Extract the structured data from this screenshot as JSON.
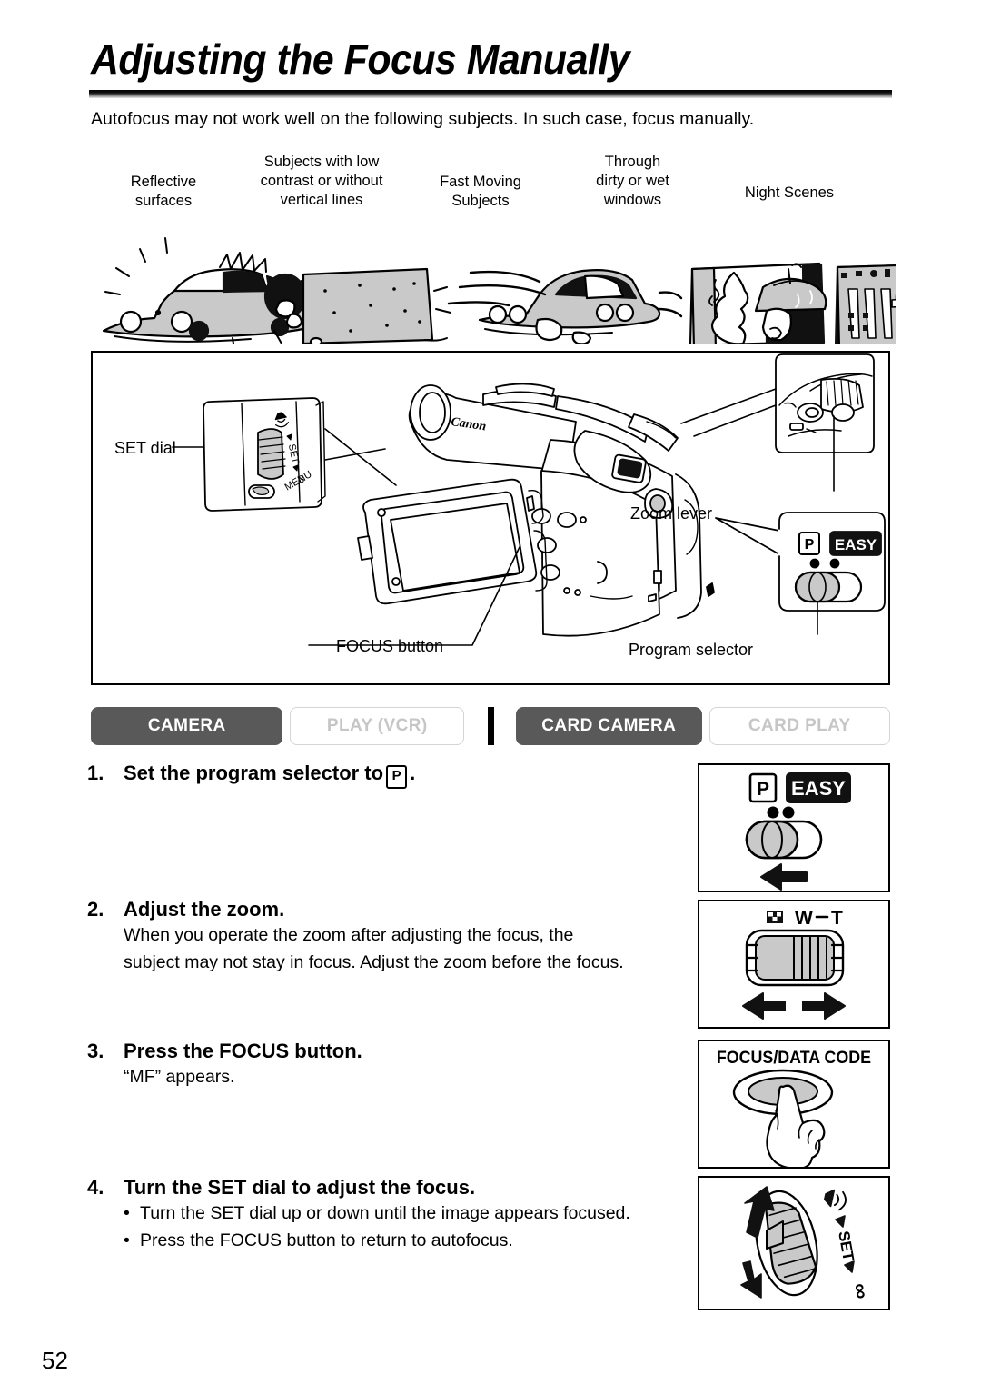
{
  "page": {
    "title": "Adjusting the Focus Manually",
    "intro": "Autofocus may not work well on the following subjects. In such case, focus manually.",
    "number": "52"
  },
  "subjects": [
    {
      "label": "Reflective\nsurfaces",
      "line1": "Reflective",
      "line2": "surfaces",
      "line3": "",
      "icon": "reflective-car-illustration"
    },
    {
      "label": "Subjects with low contrast or without vertical lines",
      "line1": "Subjects with low",
      "line2": "contrast or without",
      "line3": "vertical lines",
      "icon": "low-contrast-panel-illustration"
    },
    {
      "label": "Fast Moving Subjects",
      "line1": "Fast Moving",
      "line2": "Subjects",
      "line3": "",
      "icon": "fast-car-illustration"
    },
    {
      "label": "Through dirty or wet windows",
      "line1": "Through",
      "line2": "dirty or wet",
      "line3": "windows",
      "icon": "wet-window-illustration"
    },
    {
      "label": "Night Scenes",
      "line1": "Night Scenes",
      "line2": "",
      "line3": "",
      "icon": "night-scene-illustration"
    }
  ],
  "diagram": {
    "set_dial_label": "SET dial",
    "zoom_lever_label": "Zoom lever",
    "focus_button_label": "FOCUS button",
    "program_selector_label": "Program selector",
    "brand": "Canon",
    "menu_label": "MENU",
    "set_label": "SET",
    "program_p": "P",
    "program_easy": "EASY"
  },
  "tabs": [
    {
      "label": "CAMERA",
      "state": "active"
    },
    {
      "label": "PLAY (VCR)",
      "state": "inactive"
    },
    {
      "label": "CARD CAMERA",
      "state": "active"
    },
    {
      "label": "CARD PLAY",
      "state": "inactive"
    }
  ],
  "steps": [
    {
      "number": "1.",
      "title_before": "Set the program selector to",
      "title_glyph": "P",
      "title_after": ".",
      "body": "",
      "bullets": [],
      "figure": {
        "name": "program-selector-figure",
        "p_label": "P",
        "easy_label": "EASY",
        "arrow": "left"
      }
    },
    {
      "number": "2.",
      "title_before": "Adjust the zoom.",
      "title_glyph": "",
      "title_after": "",
      "body_line1": "When you operate the zoom after adjusting the focus, the",
      "body_line2": "subject may not stay in focus. Adjust the zoom before the focus.",
      "bullets": [],
      "figure": {
        "name": "zoom-lever-figure",
        "wide_label": "W",
        "tele_label": "T",
        "separator": "–",
        "arrow": "both"
      }
    },
    {
      "number": "3.",
      "title_before": "Press the FOCUS button.",
      "title_glyph": "",
      "title_after": "",
      "body_line1": "“MF” appears.",
      "bullets": [],
      "figure": {
        "name": "focus-button-figure",
        "button_label": "FOCUS/DATA CODE"
      }
    },
    {
      "number": "4.",
      "title_before": "Turn the SET dial to adjust the focus.",
      "title_glyph": "",
      "title_after": "",
      "body_line1": "",
      "bullets": [
        "Turn the SET dial up or down until the image appears focused.",
        "Press the FOCUS button to return to autofocus."
      ],
      "figure": {
        "name": "set-dial-figure",
        "set_label": "SET",
        "infinity_label": "∞"
      }
    }
  ],
  "colors": {
    "tab_active_bg": "#595959",
    "tab_active_text": "#ffffff",
    "tab_inactive_text": "#c6c6c6",
    "tab_inactive_border": "#d4d4d4",
    "illustration_fill": "#c9c9c9",
    "rule_dark": "#000000"
  }
}
